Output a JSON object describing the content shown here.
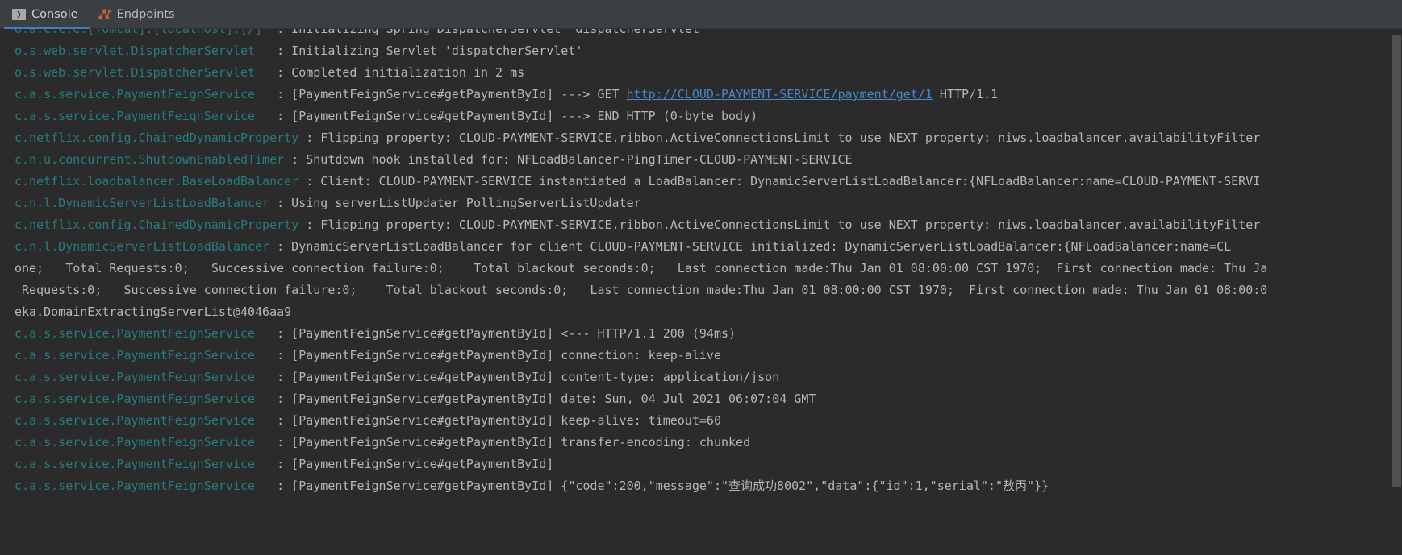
{
  "window": {
    "background_color": "#2b2b2b",
    "tabbar_background_color": "#3c3f41",
    "accent_color": "#3d7ecb",
    "logger_color": "#287b7e",
    "message_color": "#b6b6b6",
    "link_color": "#4a86c8"
  },
  "tabs": [
    {
      "id": "console",
      "label": "Console",
      "icon": "console-run-icon",
      "glyph": "❯",
      "active": true
    },
    {
      "id": "endpoints",
      "label": "Endpoints",
      "icon": "endpoints-graph-icon",
      "active": false
    }
  ],
  "console": {
    "scrollbar": {
      "orientation": "vertical",
      "thumb_top_pct": 1,
      "thumb_height_pct": 86
    },
    "lines": [
      {
        "type": "log",
        "clipped_top": true,
        "logger": "o.a.c.c.C.[Tomcat].[localhost].[/]",
        "message": ": Initializing Spring DispatcherServlet 'dispatcherServlet'"
      },
      {
        "type": "log",
        "logger": "o.s.web.servlet.DispatcherServlet",
        "message": ": Initializing Servlet 'dispatcherServlet'"
      },
      {
        "type": "log",
        "logger": "o.s.web.servlet.DispatcherServlet",
        "message": ": Completed initialization in 2 ms"
      },
      {
        "type": "log-with-link",
        "logger": "c.a.s.service.PaymentFeignService",
        "message_before": ": [PaymentFeignService#getPaymentById] ---> GET ",
        "link": "http://CLOUD-PAYMENT-SERVICE/payment/get/1",
        "message_after": " HTTP/1.1"
      },
      {
        "type": "log",
        "logger": "c.a.s.service.PaymentFeignService",
        "message": ": [PaymentFeignService#getPaymentById] ---> END HTTP (0-byte body)"
      },
      {
        "type": "log",
        "logger": "c.netflix.config.ChainedDynamicProperty",
        "message": ": Flipping property: CLOUD-PAYMENT-SERVICE.ribbon.ActiveConnectionsLimit to use NEXT property: niws.loadbalancer.availabilityFilter"
      },
      {
        "type": "log",
        "logger": "c.n.u.concurrent.ShutdownEnabledTimer",
        "message": ": Shutdown hook installed for: NFLoadBalancer-PingTimer-CLOUD-PAYMENT-SERVICE"
      },
      {
        "type": "log",
        "logger": "c.netflix.loadbalancer.BaseLoadBalancer",
        "message": ": Client: CLOUD-PAYMENT-SERVICE instantiated a LoadBalancer: DynamicServerListLoadBalancer:{NFLoadBalancer:name=CLOUD-PAYMENT-SERVI"
      },
      {
        "type": "log",
        "logger": "c.n.l.DynamicServerListLoadBalancer",
        "message": ": Using serverListUpdater PollingServerListUpdater"
      },
      {
        "type": "log",
        "logger": "c.netflix.config.ChainedDynamicProperty",
        "message": ": Flipping property: CLOUD-PAYMENT-SERVICE.ribbon.ActiveConnectionsLimit to use NEXT property: niws.loadbalancer.availabilityFilter"
      },
      {
        "type": "log",
        "logger": "c.n.l.DynamicServerListLoadBalancer",
        "message": ": DynamicServerListLoadBalancer for client CLOUD-PAYMENT-SERVICE initialized: DynamicServerListLoadBalancer:{NFLoadBalancer:name=CL"
      },
      {
        "type": "continuation",
        "text": "one;   Total Requests:0;   Successive connection failure:0;    Total blackout seconds:0;   Last connection made:Thu Jan 01 08:00:00 CST 1970;  First connection made: Thu Ja"
      },
      {
        "type": "continuation",
        "text": " Requests:0;   Successive connection failure:0;    Total blackout seconds:0;   Last connection made:Thu Jan 01 08:00:00 CST 1970;  First connection made: Thu Jan 01 08:00:0"
      },
      {
        "type": "continuation",
        "text": "eka.DomainExtractingServerList@4046aa9"
      },
      {
        "type": "log",
        "logger": "c.a.s.service.PaymentFeignService",
        "message": ": [PaymentFeignService#getPaymentById] <--- HTTP/1.1 200 (94ms)"
      },
      {
        "type": "log",
        "logger": "c.a.s.service.PaymentFeignService",
        "message": ": [PaymentFeignService#getPaymentById] connection: keep-alive"
      },
      {
        "type": "log",
        "logger": "c.a.s.service.PaymentFeignService",
        "message": ": [PaymentFeignService#getPaymentById] content-type: application/json"
      },
      {
        "type": "log",
        "logger": "c.a.s.service.PaymentFeignService",
        "message": ": [PaymentFeignService#getPaymentById] date: Sun, 04 Jul 2021 06:07:04 GMT"
      },
      {
        "type": "log",
        "logger": "c.a.s.service.PaymentFeignService",
        "message": ": [PaymentFeignService#getPaymentById] keep-alive: timeout=60"
      },
      {
        "type": "log",
        "logger": "c.a.s.service.PaymentFeignService",
        "message": ": [PaymentFeignService#getPaymentById] transfer-encoding: chunked"
      },
      {
        "type": "log",
        "logger": "c.a.s.service.PaymentFeignService",
        "message": ": [PaymentFeignService#getPaymentById]"
      },
      {
        "type": "log",
        "logger": "c.a.s.service.PaymentFeignService",
        "message": ": [PaymentFeignService#getPaymentById] {\"code\":200,\"message\":\"查询成功8002\",\"data\":{\"id\":1,\"serial\":\"敖丙\"}}"
      }
    ]
  }
}
